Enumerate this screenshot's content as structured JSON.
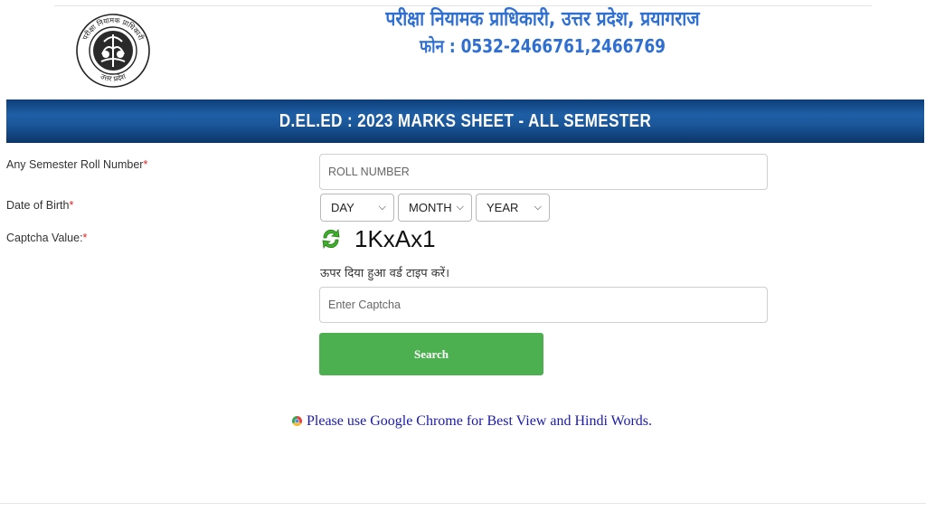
{
  "header": {
    "title": "परीक्षा नियामक प्राधिकारी, उत्तर प्रदेश, प्रयागराज",
    "phone": "फोन : 0532-2466761,2466769",
    "logo": {
      "icon": "uttar-pradesh-emblem",
      "top_text": "परीक्षा नियामक प्राधिकारी",
      "bottom_text": "उत्तर प्रदेश"
    }
  },
  "banner": {
    "title": "D.EL.ED : 2023 MARKS SHEET - ALL SEMESTER"
  },
  "form": {
    "roll_label": "Any Semester Roll Number",
    "roll_placeholder": "ROLL NUMBER",
    "dob_label": "Date of Birth",
    "day": "DAY",
    "month": "MONTH",
    "year": "YEAR",
    "captcha_label": "Captcha Value:",
    "required_mark": "*",
    "captcha_value": "1KxAx1",
    "captcha_hint": "ऊपर दिया हुआ वर्ड टाइप करें।",
    "captcha_placeholder": "Enter Captcha",
    "search_label": "Search"
  },
  "notice": {
    "text": "Please use Google Chrome for Best View and Hindi Words.",
    "icon": "chrome-icon"
  },
  "colors": {
    "heading_blue": "#2f6fd1",
    "banner_blue": "#1f5fa6",
    "button_green": "#4caf50",
    "notice_blue": "#1a1aa8",
    "required_red": "#dd2222"
  }
}
